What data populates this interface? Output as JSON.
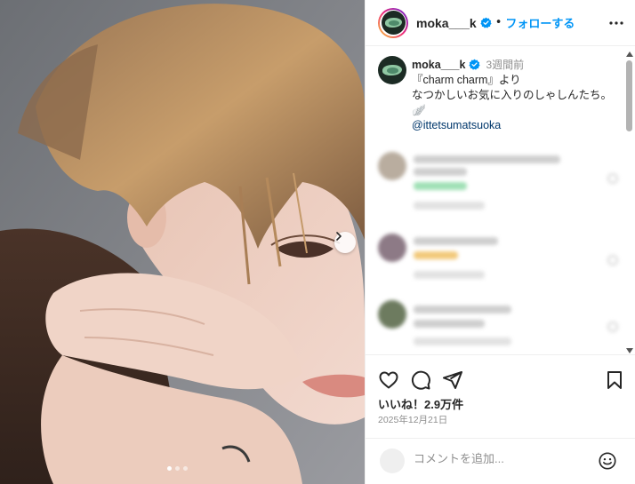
{
  "header": {
    "username": "moka___k",
    "separator": "•",
    "follow_label": "フォローする"
  },
  "caption": {
    "username": "moka___k",
    "time_ago": "3週間前",
    "line1": "『charm charm』より",
    "line2": "なつかしいお気に入りのしゃしんたち。",
    "emoji": "🪽",
    "mention": "@ittetsumatsuoka"
  },
  "footer": {
    "likes": "いいね！2.9万件",
    "date": "2025年12月21日",
    "comment_placeholder": "コメントを追加..."
  },
  "carousel": {
    "total": 3,
    "current": 1
  },
  "colors": {
    "accent": "#0095f6",
    "mention": "#00376b",
    "muted": "#8e8e8e",
    "text": "#262626"
  },
  "icons": [
    "verified-badge-icon",
    "more-options-icon",
    "chevron-right-icon",
    "heart-icon",
    "comment-icon",
    "share-icon",
    "bookmark-icon",
    "emoji-icon"
  ]
}
